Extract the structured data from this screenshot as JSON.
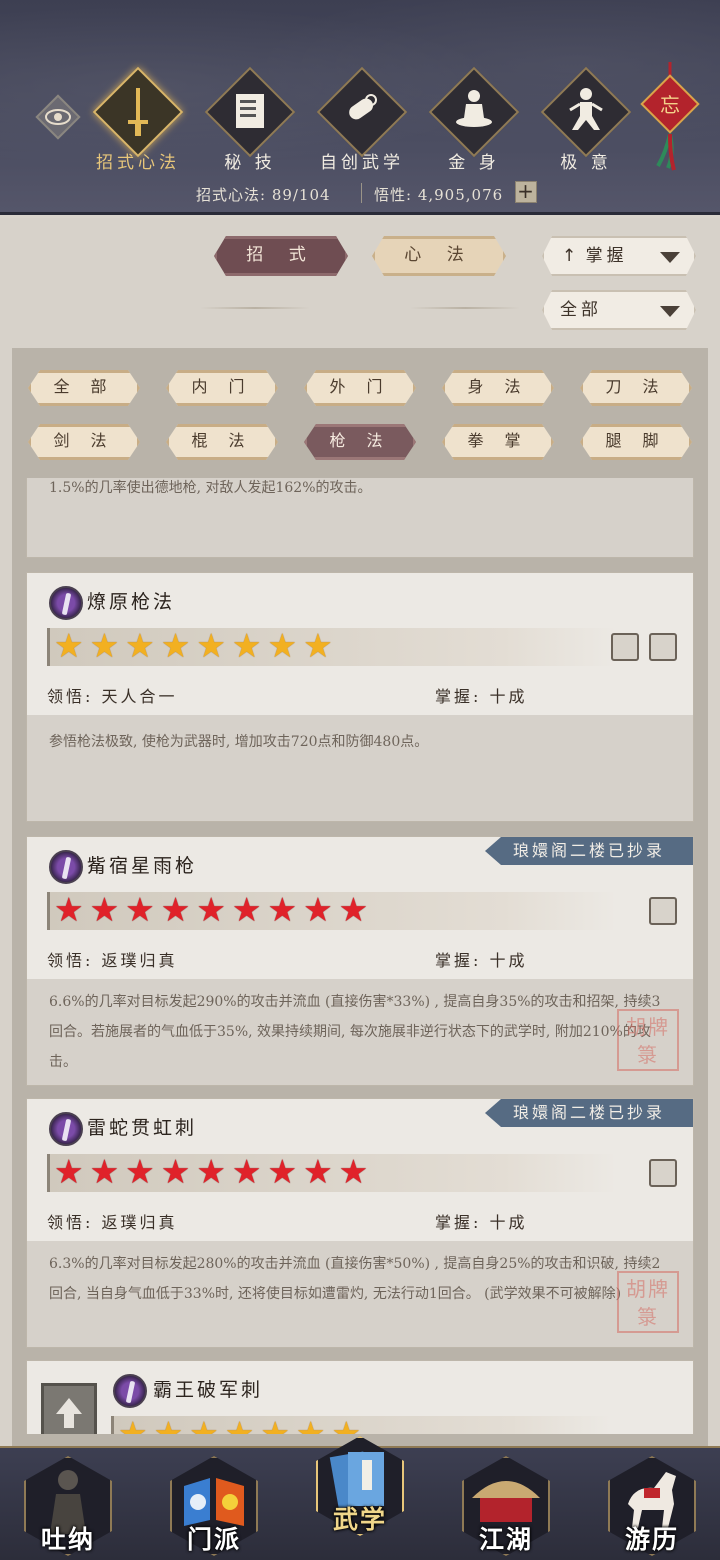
{
  "header": {
    "tabs": [
      {
        "label": "招式心法",
        "icon": "sword-icon",
        "active": true
      },
      {
        "label": "秘 技",
        "icon": "book-icon",
        "active": false
      },
      {
        "label": "自创武学",
        "icon": "scroll-icon",
        "active": false
      },
      {
        "label": "金 身",
        "icon": "meditation-icon",
        "active": false
      },
      {
        "label": "极 意",
        "icon": "martial-stance-icon",
        "active": false
      }
    ],
    "knot_char": "忘",
    "stats": {
      "skills": "招式心法: 89/104",
      "insight": "悟性: 4,905,076",
      "plus": "+"
    }
  },
  "filters": {
    "type_tabs": [
      "招 式",
      "心 法"
    ],
    "sort_select": "掌握",
    "category_select": "全部"
  },
  "chips": [
    "全 部",
    "内 门",
    "外 门",
    "身 法",
    "刀 法",
    "剑 法",
    "棍 法",
    "枪 法",
    "拳 掌",
    "腿 脚"
  ],
  "active_chip": "枪 法",
  "partial_card_text": "1.5%的几率使出德地枪, 对敌人发起162%的攻击。",
  "skills": [
    {
      "name": "燎原枪法",
      "stars": 8,
      "star_color": "gold",
      "comprehension_label": "领悟:",
      "comprehension": "天人合一",
      "mastery_label": "掌握:",
      "mastery": "十成",
      "ribbon": "",
      "description": "参悟枪法极致, 使枪为武器时, 增加攻击720点和防御480点。"
    },
    {
      "name": "觜宿星雨枪",
      "stars": 9,
      "star_color": "red",
      "comprehension_label": "领悟:",
      "comprehension": "返璞归真",
      "mastery_label": "掌握:",
      "mastery": "十成",
      "ribbon": "琅嬛阁二楼已抄录",
      "description": "6.6%的几率对目标发起290%的攻击并流血 (直接伤害*33%) , 提高自身35%的攻击和招架, 持续3回合。若施展者的气血低于35%, 效果持续期间, 每次施展非逆行状态下的武学时, 附加210%的攻击。"
    },
    {
      "name": "雷蛇贯虹刺",
      "stars": 9,
      "star_color": "red",
      "comprehension_label": "领悟:",
      "comprehension": "返璞归真",
      "mastery_label": "掌握:",
      "mastery": "十成",
      "ribbon": "琅嬛阁二楼已抄录",
      "description": "6.3%的几率对目标发起280%的攻击并流血 (直接伤害*50%) , 提高自身25%的攻击和识破, 持续2回合, 当自身气血低于33%时, 还将使目标如遭雷灼, 无法行动1回合。 (武学效果不可被解除)"
    },
    {
      "name": "霸王破军刺",
      "stars": 7,
      "star_color": "gold"
    }
  ],
  "seal_text": "胡牌\n箓",
  "nav": [
    {
      "label": "吐纳",
      "icon": "monk-silhouette-icon"
    },
    {
      "label": "门派",
      "icon": "sect-banner-icon"
    },
    {
      "label": "武学",
      "icon": "martial-book-icon",
      "active": true
    },
    {
      "label": "江湖",
      "icon": "bamboo-hat-icon"
    },
    {
      "label": "游历",
      "icon": "horse-icon"
    }
  ]
}
